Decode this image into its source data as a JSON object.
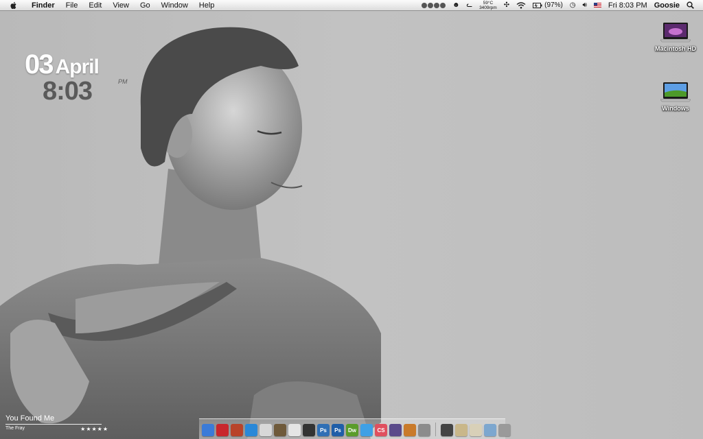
{
  "menubar": {
    "app_name": "Finder",
    "items": [
      "File",
      "Edit",
      "View",
      "Go",
      "Window",
      "Help"
    ],
    "weather_temp": "59°C",
    "weather_rpm": "3409rpm",
    "battery": "(97%)",
    "clock": "Fri 8:03 PM",
    "user": "Goosie",
    "icons": [
      "apple-icon",
      "media-controls-icon",
      "growl-icon",
      "cat-icon",
      "move-icon",
      "wifi-icon",
      "battery-icon",
      "time-machine-icon",
      "volume-icon",
      "flag-icon",
      "spotlight-icon"
    ]
  },
  "widget": {
    "day": "03",
    "month": "April",
    "time": "8:03",
    "ampm": "PM"
  },
  "desktop_icons": [
    {
      "label": "Macintosh HD",
      "icon": "hard-drive-icon"
    },
    {
      "label": "Windows",
      "icon": "windows-drive-icon"
    }
  ],
  "now_playing": {
    "title": "You Found Me",
    "artist": "The Fray",
    "rating": "★★★★★"
  },
  "dock": {
    "apps": [
      {
        "name": "finder",
        "label": "",
        "color": "#3b7bd8"
      },
      {
        "name": "red-app",
        "label": "",
        "color": "#c8272d"
      },
      {
        "name": "mail",
        "label": "",
        "color": "#b8432a"
      },
      {
        "name": "safari",
        "label": "",
        "color": "#2a88d8"
      },
      {
        "name": "itunes-cd",
        "label": "",
        "color": "#d8d8d8"
      },
      {
        "name": "iphoto",
        "label": "",
        "color": "#6f5a3b"
      },
      {
        "name": "flickr",
        "label": "",
        "color": "#e5e5e5"
      },
      {
        "name": "aperture",
        "label": "",
        "color": "#333333"
      },
      {
        "name": "photoshop",
        "label": "Ps",
        "color": "#2f6fb5"
      },
      {
        "name": "photoshop-2",
        "label": "Ps",
        "color": "#1f5ea8"
      },
      {
        "name": "dreamweaver",
        "label": "Dw",
        "color": "#5a9c2a"
      },
      {
        "name": "itunes",
        "label": "",
        "color": "#3fa0e5"
      },
      {
        "name": "creative-suite",
        "label": "CS",
        "color": "#e0505f"
      },
      {
        "name": "guitar",
        "label": "",
        "color": "#5a4a8a"
      },
      {
        "name": "preview",
        "label": "",
        "color": "#c97a2a"
      },
      {
        "name": "system-prefs",
        "label": "",
        "color": "#8c8c8c"
      }
    ],
    "stacks": [
      {
        "name": "stack-1",
        "color": "#444444"
      },
      {
        "name": "stack-2",
        "color": "#c9b78a"
      },
      {
        "name": "stack-3",
        "color": "#d8d0b8"
      },
      {
        "name": "stack-4",
        "color": "#7da7cf"
      },
      {
        "name": "trash",
        "color": "#9a9a9a"
      }
    ]
  }
}
